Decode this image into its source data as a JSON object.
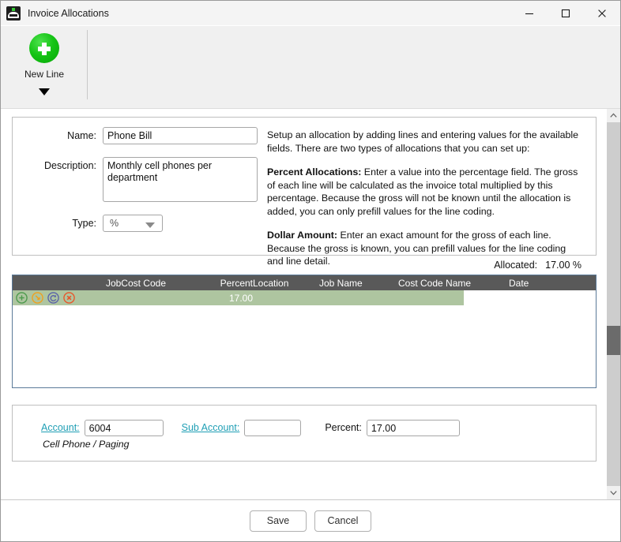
{
  "window": {
    "title": "Invoice Allocations",
    "icon": "app-icon",
    "controls": {
      "minimize": "minimize-icon",
      "maximize": "maximize-icon",
      "close": "close-icon"
    }
  },
  "toolbar": {
    "new_line_label": "New Line",
    "new_line_icon": "green-plus-icon",
    "dropdown_icon": "caret-down-icon"
  },
  "form": {
    "name_label": "Name:",
    "name_value": "Phone Bill",
    "description_label": "Description:",
    "description_value": "Monthly cell phones per department",
    "type_label": "Type:",
    "type_value": "%",
    "type_options": [
      "%",
      "$"
    ]
  },
  "help": {
    "intro": "Setup an allocation by adding lines and entering values for the available fields. There are two types of allocations that you can set up:",
    "percent_title": "Percent Allocations:",
    "percent_body": " Enter a value into the percentage field. The gross of each line will be calculated as the invoice total multiplied by this percentage. Because the gross will not be known until the allocation is added, you can only prefill values for the line coding.",
    "dollar_title": "Dollar Amount:",
    "dollar_body": " Enter an exact amount for the gross of each line. Because the gross is known, you can prefill values for the line coding and line detail."
  },
  "allocated": {
    "label": "Allocated:",
    "value": "17.00 %"
  },
  "grid": {
    "columns": [
      "JobCost Code",
      "Percent",
      "Location",
      "Job Name",
      "Cost Code Name",
      "Date"
    ],
    "row_icons": [
      "add-row-icon",
      "edit-row-icon",
      "refresh-row-icon",
      "delete-row-icon"
    ],
    "rows": [
      {
        "jobcost_code": "",
        "percent": "17.00",
        "location": "",
        "job_name": "",
        "cost_code_name": "",
        "date": ""
      }
    ]
  },
  "detail": {
    "account_label": "Account:",
    "account_value": "6004",
    "account_description": "Cell Phone / Paging",
    "sub_account_label": "Sub Account:",
    "sub_account_value": "",
    "percent_label": "Percent:",
    "percent_value": "17.00"
  },
  "footer": {
    "save_label": "Save",
    "cancel_label": "Cancel"
  },
  "colors": {
    "grid_header_bg": "#595959",
    "selected_row_bg": "#aec5a0",
    "grid_border": "#5b7a99",
    "link": "#1f9fb5",
    "accent_green": "#16c416"
  }
}
